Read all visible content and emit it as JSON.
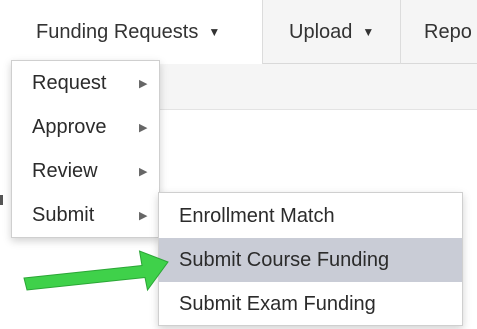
{
  "nav": {
    "tabs": [
      {
        "label": "Funding Requests",
        "caret": "▼"
      },
      {
        "label": "Upload",
        "caret": "▼"
      },
      {
        "label": "Repo"
      }
    ]
  },
  "menu": {
    "items": [
      {
        "label": "Request",
        "arrow": "▶"
      },
      {
        "label": "Approve",
        "arrow": "▶"
      },
      {
        "label": "Review",
        "arrow": "▶"
      },
      {
        "label": "Submit",
        "arrow": "▶"
      }
    ]
  },
  "submenu": {
    "items": [
      {
        "label": "Enrollment Match"
      },
      {
        "label": "Submit Course Funding",
        "highlighted": true
      },
      {
        "label": "Submit Exam Funding"
      }
    ]
  },
  "colors": {
    "highlight": "#c9ccd6",
    "pointer_arrow": "#3fd14a"
  }
}
